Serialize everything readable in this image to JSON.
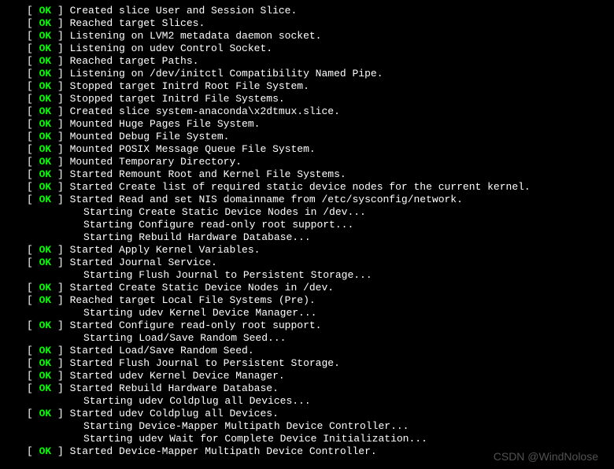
{
  "status_ok": "OK",
  "bracket_open": "[  ",
  "bracket_close": "  ] ",
  "lines": [
    {
      "type": "ok",
      "msg": "Created slice User and Session Slice."
    },
    {
      "type": "ok",
      "msg": "Reached target Slices."
    },
    {
      "type": "ok",
      "msg": "Listening on LVM2 metadata daemon socket."
    },
    {
      "type": "ok",
      "msg": "Listening on udev Control Socket."
    },
    {
      "type": "ok",
      "msg": "Reached target Paths."
    },
    {
      "type": "ok",
      "msg": "Listening on /dev/initctl Compatibility Named Pipe."
    },
    {
      "type": "ok",
      "msg": "Stopped target Initrd Root File System."
    },
    {
      "type": "ok",
      "msg": "Stopped target Initrd File Systems."
    },
    {
      "type": "ok",
      "msg": "Created slice system-anaconda\\x2dtmux.slice."
    },
    {
      "type": "ok",
      "msg": "Mounted Huge Pages File System."
    },
    {
      "type": "ok",
      "msg": "Mounted Debug File System."
    },
    {
      "type": "ok",
      "msg": "Mounted POSIX Message Queue File System."
    },
    {
      "type": "ok",
      "msg": "Mounted Temporary Directory."
    },
    {
      "type": "ok",
      "msg": "Started Remount Root and Kernel File Systems."
    },
    {
      "type": "ok",
      "msg": "Started Create list of required static device nodes for the current kernel."
    },
    {
      "type": "ok",
      "msg": "Started Read and set NIS domainname from /etc/sysconfig/network."
    },
    {
      "type": "starting",
      "msg": "Starting Create Static Device Nodes in /dev..."
    },
    {
      "type": "starting",
      "msg": "Starting Configure read-only root support..."
    },
    {
      "type": "starting",
      "msg": "Starting Rebuild Hardware Database..."
    },
    {
      "type": "ok",
      "msg": "Started Apply Kernel Variables."
    },
    {
      "type": "ok",
      "msg": "Started Journal Service."
    },
    {
      "type": "starting",
      "msg": "Starting Flush Journal to Persistent Storage..."
    },
    {
      "type": "ok",
      "msg": "Started Create Static Device Nodes in /dev."
    },
    {
      "type": "ok",
      "msg": "Reached target Local File Systems (Pre)."
    },
    {
      "type": "starting",
      "msg": "Starting udev Kernel Device Manager..."
    },
    {
      "type": "ok",
      "msg": "Started Configure read-only root support."
    },
    {
      "type": "starting",
      "msg": "Starting Load/Save Random Seed..."
    },
    {
      "type": "ok",
      "msg": "Started Load/Save Random Seed."
    },
    {
      "type": "ok",
      "msg": "Started Flush Journal to Persistent Storage."
    },
    {
      "type": "ok",
      "msg": "Started udev Kernel Device Manager."
    },
    {
      "type": "ok",
      "msg": "Started Rebuild Hardware Database."
    },
    {
      "type": "starting",
      "msg": "Starting udev Coldplug all Devices..."
    },
    {
      "type": "ok",
      "msg": "Started udev Coldplug all Devices."
    },
    {
      "type": "starting",
      "msg": "Starting Device-Mapper Multipath Device Controller..."
    },
    {
      "type": "starting",
      "msg": "Starting udev Wait for Complete Device Initialization..."
    },
    {
      "type": "ok",
      "msg": "Started Device-Mapper Multipath Device Controller."
    }
  ],
  "watermark": "CSDN @WindNolose"
}
